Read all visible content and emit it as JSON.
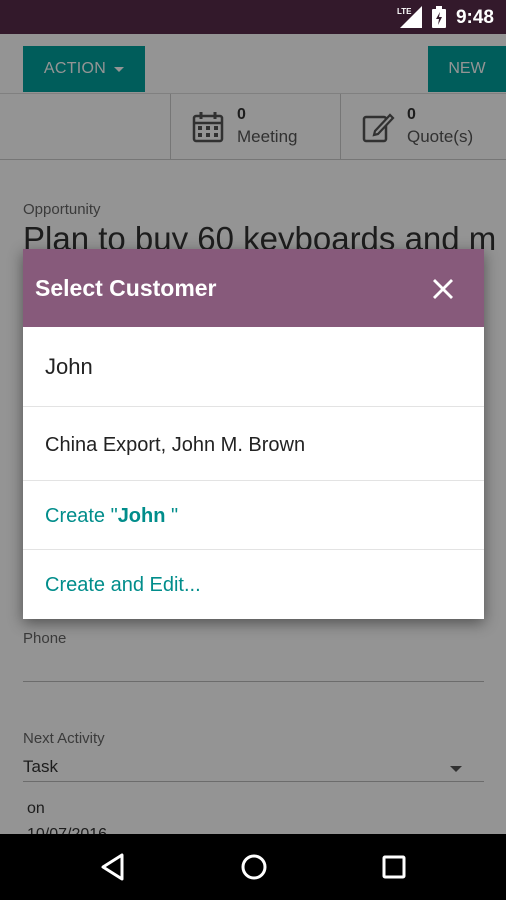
{
  "status_bar": {
    "network": "LTE",
    "time": "9:48"
  },
  "control_panel": {
    "action_label": "ACTION",
    "new_label": "NEW"
  },
  "stat_buttons": [
    {
      "icon": "calendar-icon",
      "count": "0",
      "label": "Meeting"
    },
    {
      "icon": "edit-document-icon",
      "count": "0",
      "label": "Quote(s)"
    }
  ],
  "form": {
    "opportunity_label": "Opportunity",
    "opportunity_title": "Plan to buy 60 keyboards and m",
    "phone_label": "Phone",
    "next_activity_label": "Next Activity",
    "next_activity_value": "Task",
    "on_label": "on",
    "date_value": "10/07/2016"
  },
  "dialog": {
    "title": "Select Customer",
    "search_value": "John",
    "results": [
      "China Export, John M. Brown"
    ],
    "create_prefix": "Create \"",
    "create_term": "John",
    "create_suffix": " \"",
    "create_edit_label": "Create and Edit..."
  },
  "colors": {
    "header": "#875a7b",
    "primary": "#00a09d",
    "link": "#018d8b",
    "status_bar": "#33192b"
  },
  "nav_bar": {
    "icons": [
      "back-icon",
      "home-icon",
      "recents-icon"
    ]
  }
}
